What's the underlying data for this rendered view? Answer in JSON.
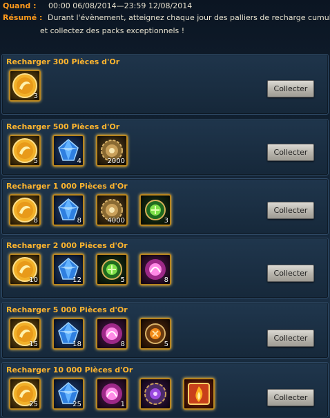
{
  "event": {
    "when_label": "Quand :",
    "when_value": "00:00 06/08/2014—23:59 12/08/2014",
    "summary_label": "Résumé :",
    "summary_line1": "Durant l'évènement, atteignez chaque jour des palliers de recharge cumulée",
    "summary_line2": "et collectez des packs exceptionnels !"
  },
  "tiers": [
    {
      "title": "Recharger  300 Pièces d'Or",
      "button": "Collecter",
      "items": [
        {
          "icon": "gold-coin-icon",
          "qty": "3"
        }
      ]
    },
    {
      "title": "Recharger  500 Pièces d'Or",
      "button": "Collecter",
      "items": [
        {
          "icon": "gold-coin-icon",
          "qty": "5"
        },
        {
          "icon": "blue-crystal-icon",
          "qty": "4"
        },
        {
          "icon": "bronze-gear-icon",
          "qty": "2000"
        }
      ]
    },
    {
      "title": "Recharger  1 000 Pièces d'Or",
      "button": "Collecter",
      "items": [
        {
          "icon": "gold-coin-icon",
          "qty": "8"
        },
        {
          "icon": "blue-crystal-icon",
          "qty": "8"
        },
        {
          "icon": "bronze-gear-icon",
          "qty": "4000"
        },
        {
          "icon": "green-orb-icon",
          "qty": "3"
        }
      ]
    },
    {
      "title": "Recharger  2 000 Pièces d'Or",
      "button": "Collecter",
      "items": [
        {
          "icon": "gold-coin-icon",
          "qty": "10"
        },
        {
          "icon": "blue-crystal-icon",
          "qty": "12"
        },
        {
          "icon": "green-orb-icon",
          "qty": "5"
        },
        {
          "icon": "pink-orb-icon",
          "qty": "8"
        }
      ]
    },
    {
      "title": "Recharger  5 000 Pièces d'Or",
      "button": "Collecter",
      "items": [
        {
          "icon": "gold-coin-icon",
          "qty": "15"
        },
        {
          "icon": "blue-crystal-icon",
          "qty": "18"
        },
        {
          "icon": "pink-orb-icon",
          "qty": "8"
        },
        {
          "icon": "orange-orb-icon",
          "qty": "5"
        }
      ]
    },
    {
      "title": "Recharger  10 000 Pièces d'Or",
      "button": "Collecter",
      "items": [
        {
          "icon": "gold-coin-icon",
          "qty": "25"
        },
        {
          "icon": "blue-crystal-icon",
          "qty": "25"
        },
        {
          "icon": "pink-orb-icon",
          "qty": "1"
        },
        {
          "icon": "purple-amulet-icon",
          "qty": ""
        },
        {
          "icon": "fire-card-icon",
          "qty": ""
        }
      ]
    }
  ],
  "colors": {
    "label_orange": "#ff9a1c",
    "title_gold": "#ffb52e",
    "text": "#e8e2cf"
  }
}
